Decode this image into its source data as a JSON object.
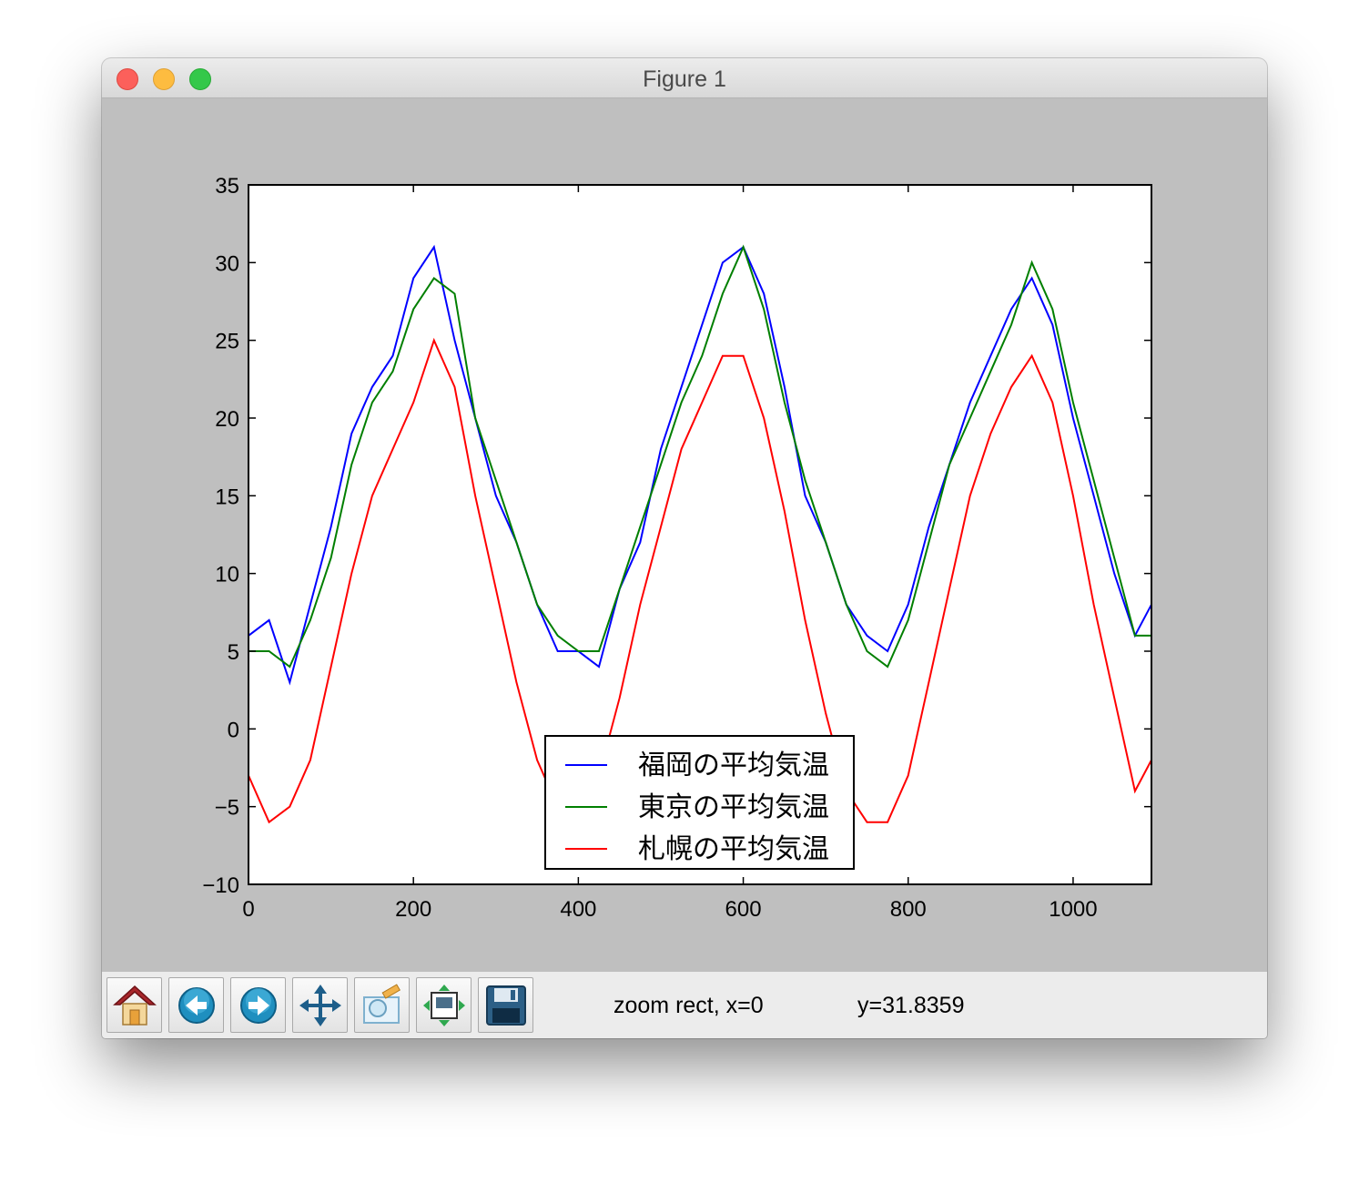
{
  "window": {
    "title": "Figure 1",
    "traffic_lights": [
      "close",
      "minimize",
      "maximize"
    ]
  },
  "toolbar": {
    "buttons": [
      {
        "name": "home",
        "icon": "home-icon"
      },
      {
        "name": "back",
        "icon": "back-arrow-icon"
      },
      {
        "name": "forward",
        "icon": "forward-arrow-icon"
      },
      {
        "name": "pan",
        "icon": "pan-move-icon"
      },
      {
        "name": "zoom",
        "icon": "zoom-rect-icon"
      },
      {
        "name": "subplots",
        "icon": "subplots-config-icon"
      },
      {
        "name": "save",
        "icon": "save-floppy-icon"
      }
    ],
    "status_mode_x": "zoom rect, x=0",
    "status_y": "y=31.8359"
  },
  "colors": {
    "fukuoka": "#0000ff",
    "tokyo": "#007f00",
    "sapporo": "#ff0000",
    "figure_bg": "#bfbfbf",
    "axes_bg": "#ffffff"
  },
  "chart_data": {
    "type": "line",
    "title": "",
    "xlabel": "",
    "ylabel": "",
    "xlim": [
      0,
      1095
    ],
    "ylim": [
      -10,
      35
    ],
    "xticks": [
      0,
      200,
      400,
      600,
      800,
      1000
    ],
    "yticks": [
      -10,
      -5,
      0,
      5,
      10,
      15,
      20,
      25,
      30,
      35
    ],
    "ytick_labels": [
      "−10",
      "−5",
      "0",
      "5",
      "10",
      "15",
      "20",
      "25",
      "30",
      "35"
    ],
    "grid": false,
    "legend_position": "lower center",
    "series": [
      {
        "name": "福岡の平均気温",
        "color": "#0000ff",
        "x": [
          0,
          25,
          50,
          75,
          100,
          125,
          150,
          175,
          200,
          225,
          250,
          275,
          300,
          325,
          350,
          375,
          400,
          425,
          450,
          475,
          500,
          525,
          550,
          575,
          600,
          625,
          650,
          675,
          700,
          725,
          750,
          775,
          800,
          825,
          850,
          875,
          900,
          925,
          950,
          975,
          1000,
          1025,
          1050,
          1075,
          1095
        ],
        "y": [
          6,
          7,
          3,
          8,
          13,
          19,
          22,
          24,
          29,
          31,
          25,
          20,
          15,
          12,
          8,
          5,
          5,
          4,
          9,
          12,
          18,
          22,
          26,
          30,
          31,
          28,
          22,
          15,
          12,
          8,
          6,
          5,
          8,
          13,
          17,
          21,
          24,
          27,
          29,
          26,
          20,
          15,
          10,
          6,
          8
        ]
      },
      {
        "name": "東京の平均気温",
        "color": "#007f00",
        "x": [
          0,
          25,
          50,
          75,
          100,
          125,
          150,
          175,
          200,
          225,
          250,
          275,
          300,
          325,
          350,
          375,
          400,
          425,
          450,
          475,
          500,
          525,
          550,
          575,
          600,
          625,
          650,
          675,
          700,
          725,
          750,
          775,
          800,
          825,
          850,
          875,
          900,
          925,
          950,
          975,
          1000,
          1025,
          1050,
          1075,
          1095
        ],
        "y": [
          5,
          5,
          4,
          7,
          11,
          17,
          21,
          23,
          27,
          29,
          28,
          20,
          16,
          12,
          8,
          6,
          5,
          5,
          9,
          13,
          17,
          21,
          24,
          28,
          31,
          27,
          21,
          16,
          12,
          8,
          5,
          4,
          7,
          12,
          17,
          20,
          23,
          26,
          30,
          27,
          21,
          16,
          11,
          6,
          6
        ]
      },
      {
        "name": "札幌の平均気温",
        "color": "#ff0000",
        "x": [
          0,
          25,
          50,
          75,
          100,
          125,
          150,
          175,
          200,
          225,
          250,
          275,
          300,
          325,
          350,
          375,
          400,
          425,
          450,
          475,
          500,
          525,
          550,
          575,
          600,
          625,
          650,
          675,
          700,
          725,
          750,
          775,
          800,
          825,
          850,
          875,
          900,
          925,
          950,
          975,
          1000,
          1025,
          1050,
          1075,
          1095
        ],
        "y": [
          -3,
          -6,
          -5,
          -2,
          4,
          10,
          15,
          18,
          21,
          25,
          22,
          15,
          9,
          3,
          -2,
          -5,
          -4,
          -3,
          2,
          8,
          13,
          18,
          21,
          24,
          24,
          20,
          14,
          7,
          1,
          -4,
          -6,
          -6,
          -3,
          3,
          9,
          15,
          19,
          22,
          24,
          21,
          15,
          8,
          2,
          -4,
          -2
        ]
      }
    ]
  }
}
